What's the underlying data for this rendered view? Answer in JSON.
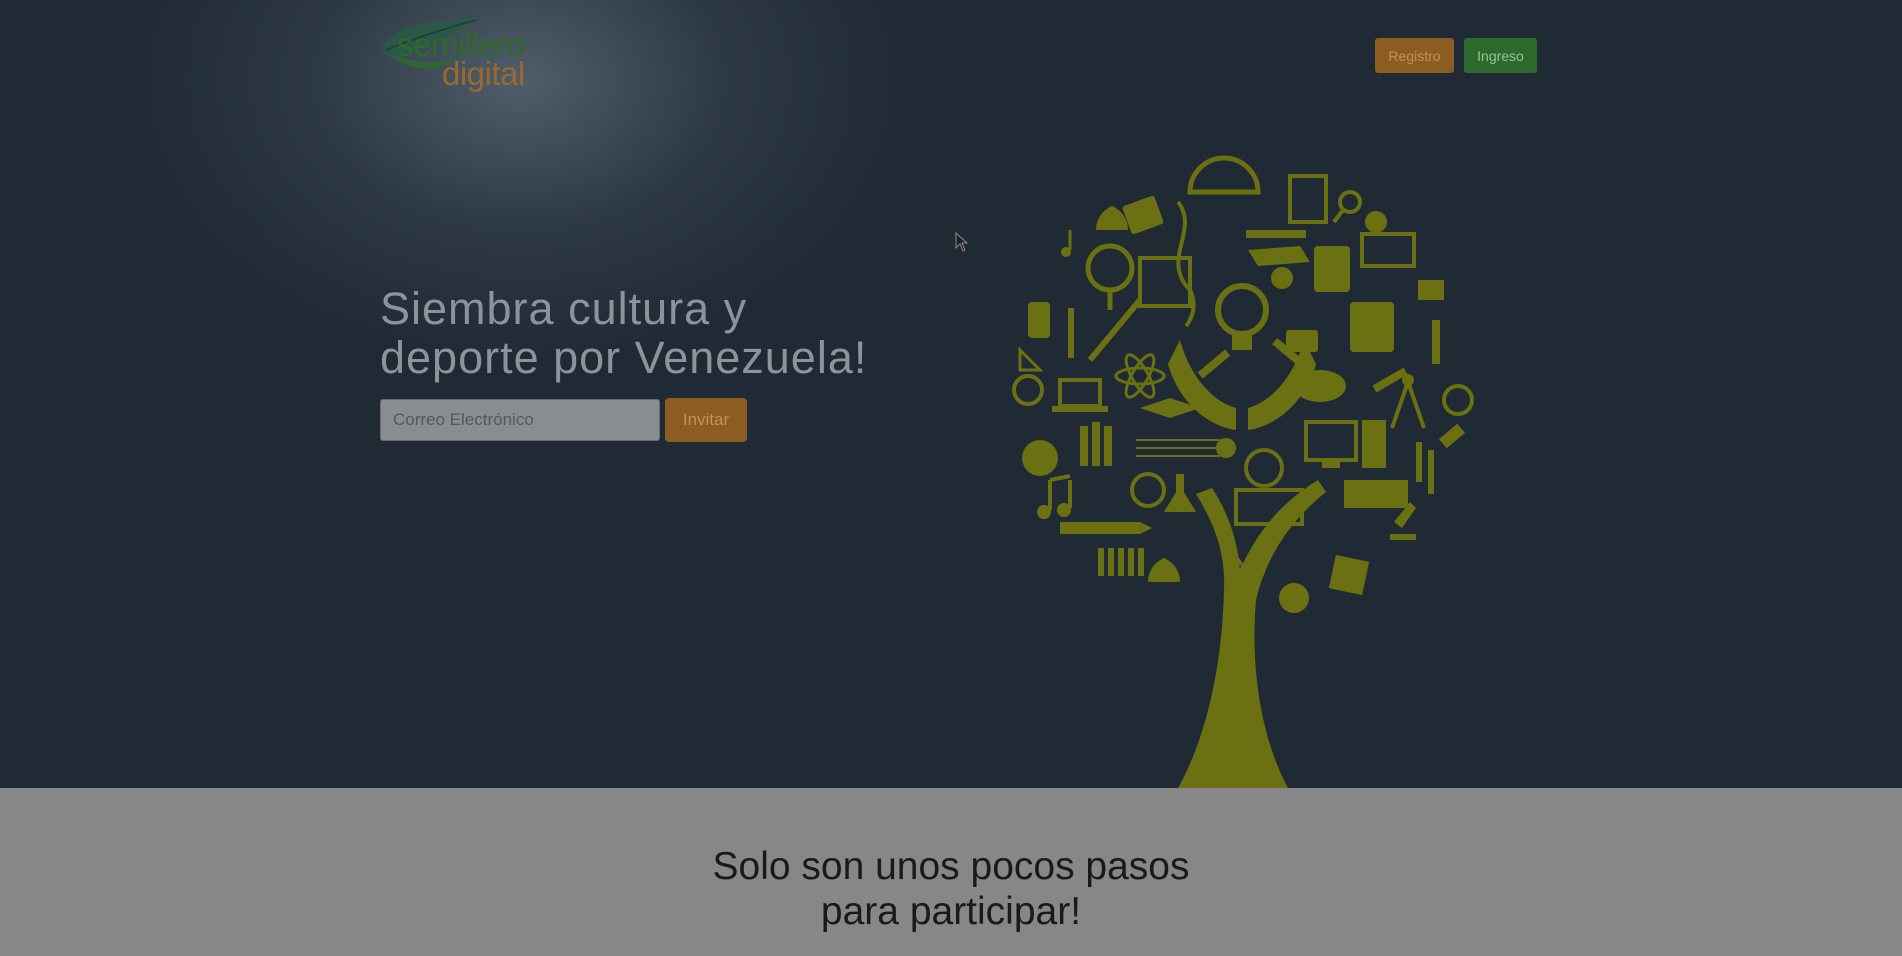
{
  "header": {
    "logo": {
      "word1": "semillero",
      "word2": "digital"
    },
    "nav": {
      "registro_label": "Registro",
      "ingreso_label": "Ingreso"
    }
  },
  "hero": {
    "headline_line1": "Siembra cultura y",
    "headline_line2": "deporte por Venezuela!",
    "email_placeholder": "Correo Electrónico",
    "invite_label": "Invitar",
    "illustration": "education-tree-icon"
  },
  "steps": {
    "title_line1": "Solo son unos pocos pasos",
    "title_line2": "para participar!"
  },
  "colors": {
    "hero_bg": "#1f2a35",
    "accent_orange": "#8b5d22",
    "accent_green": "#2e6a2c",
    "tree_olive": "#6b7013",
    "steps_bg": "#878787"
  }
}
